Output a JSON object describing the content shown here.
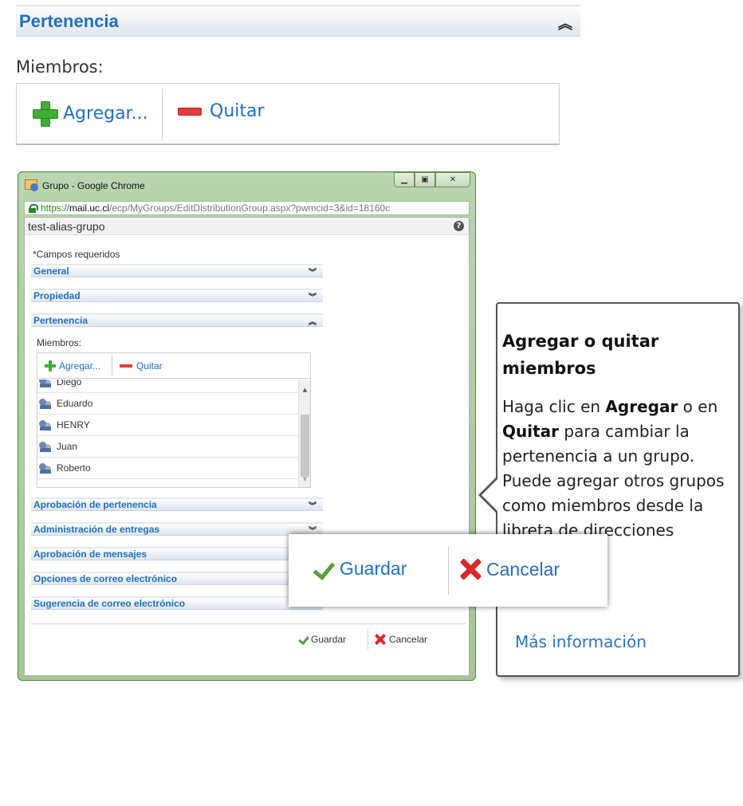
{
  "top": {
    "section_title": "Pertenencia",
    "collapse_icon": "chevron-double-up-icon",
    "members_label": "Miembros:",
    "add_label": "Agregar...",
    "remove_label": "Quitar"
  },
  "window": {
    "title": "Grupo - Google Chrome",
    "url_scheme": "https://",
    "url_host": "mail.uc.cl",
    "url_path": "/ecp/MyGroups/EditDistributionGroup.aspx?pwmcid=3&id=18160c",
    "page_title": "test-alias-grupo",
    "required_note": "*Campos requeridos",
    "sections": {
      "general": "General",
      "propiedad": "Propiedad",
      "pertenencia": "Pertenencia",
      "aprobacion_pertenencia": "Aprobación de pertenencia",
      "administracion_entregas": "Administración de entregas",
      "aprobacion_mensajes": "Aprobación de mensajes",
      "opciones_correo": "Opciones de correo electrónico",
      "sugerencia_correo": "Sugerencia de correo electrónico"
    },
    "members_label": "Miembros:",
    "add_label": "Agregar...",
    "remove_label": "Quitar",
    "members": [
      "Diego",
      "Eduardo",
      "HENRY",
      "Juan",
      "Roberto"
    ],
    "save_label": "Guardar",
    "cancel_label": "Cancelar"
  },
  "callout": {
    "title": "Agregar o quitar miembros",
    "body_1": "Haga clic en ",
    "body_add": "Agregar",
    "body_2": " o en ",
    "body_remove": "Quitar",
    "body_3": " para cambiar la pertenencia a un grupo. Puede agregar otros grupos como miembros desde la libreta de direcciones compartida.",
    "link": "Más información"
  },
  "footer": {
    "save_label": "Guardar",
    "cancel_label": "Cancelar"
  },
  "colors": {
    "link_blue": "#1f6fc5",
    "add_green": "#3fae33",
    "remove_red": "#e53c3c",
    "window_frame": "#b9d6ae"
  }
}
